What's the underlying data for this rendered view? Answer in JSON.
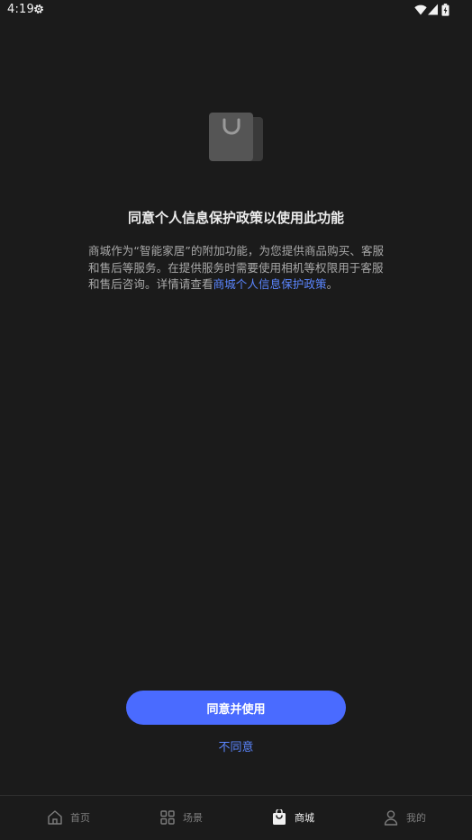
{
  "status_bar": {
    "time": "4:19",
    "icons": [
      "settings-gear-icon",
      "wifi-icon",
      "cellular-signal-icon",
      "battery-charging-icon"
    ]
  },
  "hero": {
    "icon": "shopping-bag-icon"
  },
  "content": {
    "title": "同意个人信息保护政策以使用此功能",
    "description_text": "商城作为“智能家居”的附加功能，为您提供商品购买、客服和售后等服务。在提供服务时需要使用相机等权限用于客服和售后咨询。详情请查看",
    "policy_link": "商城个人信息保护政策",
    "description_end": "。"
  },
  "actions": {
    "agree_label": "同意并使用",
    "disagree_label": "不同意"
  },
  "colors": {
    "background": "#1b1b1b",
    "accent": "#4a6bff",
    "link": "#5b86ff"
  },
  "bottom_nav": {
    "items": [
      {
        "label": "首页",
        "icon": "home-icon",
        "active": false
      },
      {
        "label": "场景",
        "icon": "grid-icon",
        "active": false
      },
      {
        "label": "商城",
        "icon": "shopping-bag-icon",
        "active": true
      },
      {
        "label": "我的",
        "icon": "person-icon",
        "active": false
      }
    ]
  }
}
